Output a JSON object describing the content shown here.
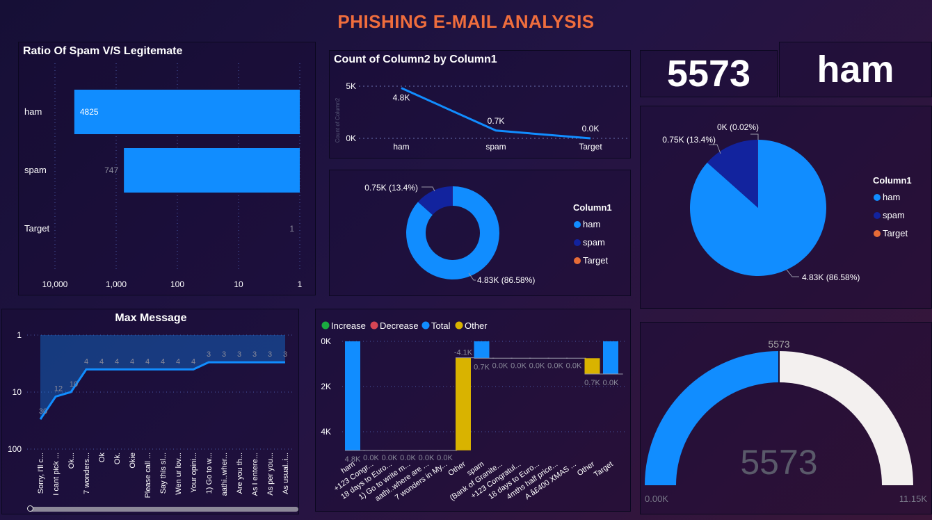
{
  "header": {
    "title": "PHISHING E-MAIL ANALYSIS"
  },
  "colors": {
    "ham": "#118dff",
    "spam": "#12239e",
    "target": "#e66c37",
    "increase": "#1aab40",
    "decrease": "#d64554",
    "total": "#118dff",
    "other": "#d9b300",
    "gauge_bg": "#f3f0ef"
  },
  "cards": {
    "total": "5573",
    "top_label": "ham"
  },
  "chart_data": [
    {
      "id": "ratio",
      "type": "bar",
      "orientation": "horizontal",
      "title": "Ratio Of Spam V/S Legitemate",
      "categories": [
        "ham",
        "spam",
        "Target"
      ],
      "values": [
        4825,
        747,
        1
      ],
      "data_labels": [
        "4825",
        "747",
        "1"
      ],
      "x_scale": "log",
      "x_reversed": true,
      "x_ticks": [
        "10,000",
        "1,000",
        "100",
        "10",
        "1"
      ],
      "grid": true
    },
    {
      "id": "count_line",
      "type": "line",
      "title": "Count of Column2 by Column1",
      "ylabel": "Count of Column2",
      "categories": [
        "ham",
        "spam",
        "Target"
      ],
      "values": [
        4825,
        747,
        1
      ],
      "data_labels": [
        "4.8K",
        "0.7K",
        "0.0K"
      ],
      "y_ticks": [
        "5K",
        "0K"
      ],
      "ylim": [
        0,
        5000
      ],
      "grid": true
    },
    {
      "id": "donut",
      "type": "pie",
      "style": "donut",
      "legend_title": "Column1",
      "legend_position": "right",
      "labels": [
        "ham",
        "spam",
        "Target"
      ],
      "values": [
        4825,
        747,
        1
      ],
      "slice_labels": [
        "4.83K (86.58%)",
        "0.75K (13.4%)",
        ""
      ]
    },
    {
      "id": "pie",
      "type": "pie",
      "legend_title": "Column1",
      "legend_position": "right",
      "labels": [
        "ham",
        "spam",
        "Target"
      ],
      "values": [
        4825,
        747,
        1
      ],
      "slice_labels": [
        "4.83K (86.58%)",
        "0.75K (13.4%)",
        "0K (0.02%)"
      ]
    },
    {
      "id": "max_message",
      "type": "area",
      "title": "Max Message",
      "y_scale": "log",
      "y_reversed": true,
      "y_ticks": [
        "1",
        "10",
        "100"
      ],
      "categories": [
        "Sorry, I'll c...",
        "I cant pick ...",
        "Ok...",
        "7 wonders...",
        "Ok",
        "Ok.",
        "Okie",
        "Please call ...",
        "Say this sl...",
        "Wen ur lov...",
        "Your opini...",
        "1) Go to w...",
        "aathi..wher...",
        "Are you th...",
        "As I entere...",
        "As per you...",
        "As usual..i..."
      ],
      "values": [
        30,
        12,
        10,
        4,
        4,
        4,
        4,
        4,
        4,
        4,
        4,
        3,
        3,
        3,
        3,
        3,
        3
      ],
      "data_labels": [
        "30",
        "12",
        "10",
        "4",
        "4",
        "4",
        "4",
        "4",
        "4",
        "4",
        "4",
        "3",
        "3",
        "3",
        "3",
        "3",
        "3"
      ]
    },
    {
      "id": "waterfall",
      "type": "bar",
      "style": "waterfall",
      "legend": [
        "Increase",
        "Decrease",
        "Total",
        "Other"
      ],
      "legend_position": "top-left",
      "y_ticks": [
        "0K",
        "2K",
        "4K"
      ],
      "ylim": [
        0,
        5000
      ],
      "y_reversed": true,
      "categories": [
        "ham",
        "+123 Congr...",
        "18 days to Euro...",
        "1) Go to write m...",
        "aathi..where are ...",
        "7 wonders in My...",
        "Other",
        "spam",
        "(Bank of Granite...",
        "+123 Congratul...",
        "18 days to Euro...",
        "4mths half price...",
        "A å£400 XMAS ...",
        "Other",
        "Target"
      ],
      "kinds": [
        "total",
        "other",
        "other",
        "other",
        "other",
        "other",
        "other",
        "total",
        "other",
        "other",
        "other",
        "other",
        "other",
        "other",
        "total"
      ],
      "values": [
        4825,
        0,
        0,
        0,
        0,
        0,
        -4100,
        747,
        0,
        0,
        0,
        0,
        0,
        700,
        0
      ],
      "data_labels": [
        "4.8K",
        "0.0K",
        "0.0K",
        "0.0K",
        "0.0K",
        "0.0K",
        "-4.1K",
        "0.7K",
        "0.0K",
        "0.0K",
        "0.0K",
        "0.0K",
        "0.0K",
        "0.7K",
        "0.0K"
      ]
    },
    {
      "id": "gauge",
      "type": "gauge",
      "value": 5573,
      "min": 0,
      "max": 11146,
      "value_label": "5573",
      "target_label": "5573",
      "min_label": "0.00K",
      "max_label": "11.15K"
    }
  ]
}
